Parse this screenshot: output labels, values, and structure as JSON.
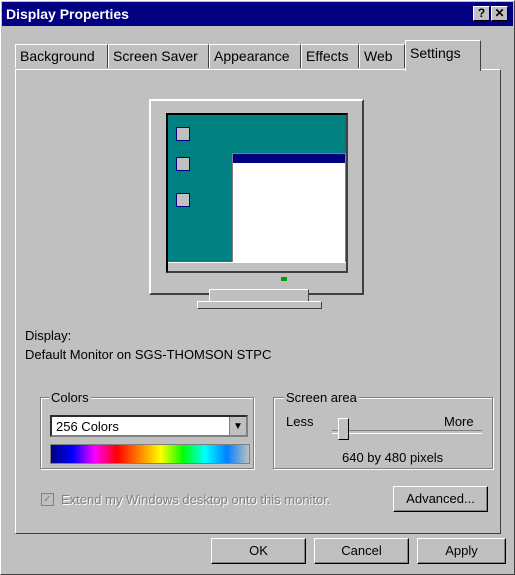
{
  "window": {
    "title": "Display Properties",
    "help_label": "?",
    "close_label": "✕"
  },
  "tabs": [
    {
      "label": "Background"
    },
    {
      "label": "Screen Saver"
    },
    {
      "label": "Appearance"
    },
    {
      "label": "Effects"
    },
    {
      "label": "Web"
    },
    {
      "label": "Settings",
      "active": true
    }
  ],
  "display": {
    "label": "Display:",
    "device": "Default Monitor on SGS-THOMSON STPC"
  },
  "colors": {
    "legend": "Colors",
    "selected": "256 Colors"
  },
  "screen_area": {
    "legend": "Screen area",
    "less": "Less",
    "more": "More",
    "resolution": "640 by 480 pixels"
  },
  "extend_checkbox": {
    "label": "Extend my Windows desktop onto this monitor.",
    "checked": true
  },
  "buttons": {
    "advanced": "Advanced...",
    "ok": "OK",
    "cancel": "Cancel",
    "apply": "Apply"
  }
}
